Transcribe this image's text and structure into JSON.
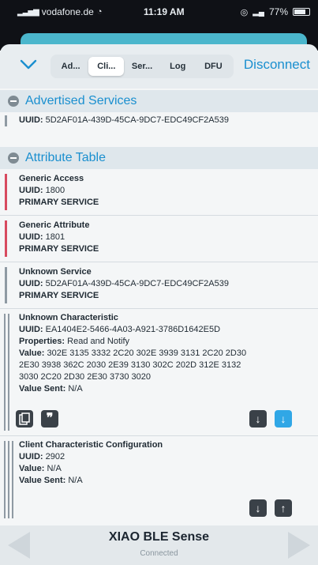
{
  "statusbar": {
    "carrier": "vodafone.de",
    "time": "11:19 AM",
    "battery": "77%",
    "battery_level": 0.77
  },
  "nav": {
    "tabs": [
      {
        "label": "Ad...",
        "active": false
      },
      {
        "label": "Cli...",
        "active": true
      },
      {
        "label": "Ser...",
        "active": false
      },
      {
        "label": "Log",
        "active": false
      },
      {
        "label": "DFU",
        "active": false
      }
    ],
    "disconnect_label": "Disconnect"
  },
  "advertised": {
    "title": "Advertised Services",
    "uuid_label": "UUID:",
    "uuid": "5D2AF01A-439D-45CA-9DC7-EDC49CF2A539"
  },
  "attributes": {
    "title": "Attribute Table",
    "items": [
      {
        "name": "Generic Access",
        "uuid_label": "UUID:",
        "uuid": "1800",
        "type": "PRIMARY SERVICE",
        "bar_color": "#d74a5f"
      },
      {
        "name": "Generic Attribute",
        "uuid_label": "UUID:",
        "uuid": "1801",
        "type": "PRIMARY SERVICE",
        "bar_color": "#d74a5f"
      },
      {
        "name": "Unknown Service",
        "uuid_label": "UUID:",
        "uuid": "5D2AF01A-439D-45CA-9DC7-EDC49CF2A539",
        "type": "PRIMARY SERVICE",
        "bar_color": "#8f9aa3"
      }
    ],
    "characteristic": {
      "name": "Unknown Characteristic",
      "uuid_label": "UUID:",
      "uuid": "EA1404E2-5466-4A03-A921-3786D1642E5D",
      "properties_label": "Properties:",
      "properties": "Read and Notify",
      "value_label": "Value:",
      "value_line1": "302E 3135 3332 2C20 302E 3939 3131 2C20 2D30",
      "value_line2": "2E30 3938 362C 2030 2E39 3130 302C 202D 312E 3132",
      "value_line3": "3030 2C20 2D30 2E30 3730 3020",
      "value_sent_label": "Value Sent:",
      "value_sent": "N/A"
    },
    "descriptor": {
      "name": "Client Characteristic Configuration",
      "uuid_label": "UUID:",
      "uuid": "2902",
      "value_label": "Value:",
      "value": "N/A",
      "value_sent_label": "Value Sent:",
      "value_sent": "N/A"
    }
  },
  "bottom": {
    "device_name": "XIAO BLE Sense",
    "status": "Connected"
  },
  "colors": {
    "accent": "#1a8fcf",
    "read_button": "#3a4148",
    "notify_button": "#30a7e6"
  },
  "icons": {
    "copy": "copy-icon",
    "quote": "quote-icon",
    "read": "arrow-down-icon",
    "notify": "notify-arrow-icon",
    "write": "arrow-up-icon"
  }
}
